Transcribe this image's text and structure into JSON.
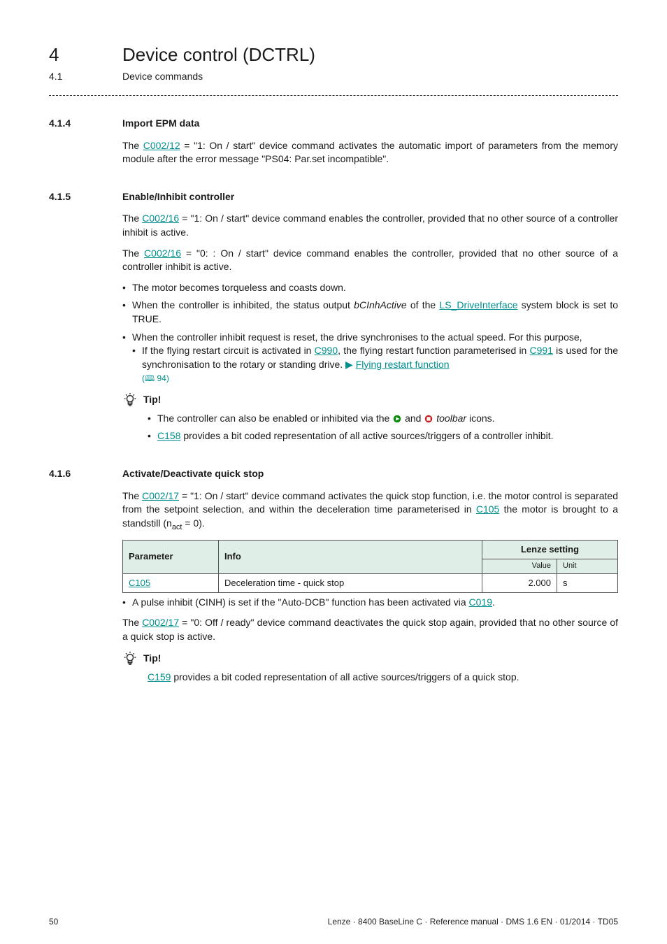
{
  "header": {
    "num": "4",
    "title": "Device control (DCTRL)"
  },
  "subheader": {
    "num": "4.1",
    "title": "Device commands"
  },
  "s414": {
    "num": "4.1.4",
    "title": "Import EPM data",
    "p1a": "The ",
    "p1link": "C002/12",
    "p1b": " = \"1: On / start\" device command activates the automatic import of parameters from the memory module after the error message \"PS04: Par.set incompatible\"."
  },
  "s415": {
    "num": "4.1.5",
    "title": "Enable/Inhibit controller",
    "p1a": "The ",
    "p1link": "C002/16",
    "p1b": " = \"1: On / start\" device command enables the controller, provided that no other source of a controller inhibit is active.",
    "p2a": "The ",
    "p2link": "C002/16",
    "p2b": " = \"0: : On / start\" device command enables the controller, provided that no other sour­ce of a controller inhibit is active.",
    "b1": "The motor becomes torqueless and coasts down.",
    "b2a": "When the controller is inhibited, the status output ",
    "b2italic": "bCInhActive",
    "b2b": " of the ",
    "b2link": "LS_DriveInterface",
    "b2c": " system block is set to TRUE.",
    "b3": "When the controller inhibit request is reset, the drive synchronises to the actual speed. For this purpose,",
    "b3sub_a": "If the flying restart circuit is activated in ",
    "b3sub_l1": "C990",
    "b3sub_b": ", the flying restart function parameterised in ",
    "b3sub_l2": "C991",
    "b3sub_c": " is used for the synchronisation to the rotary or standing drive.  ",
    "b3sub_arrow": "▶",
    "b3sub_l3": "Flying restart function",
    "b3sub_page": "(🕮 94)",
    "tip_label": "Tip!",
    "tip_b1a": "The controller can also be enabled or inhibited via the ",
    "tip_b1b": " and ",
    "tip_b1c": " ",
    "tip_b1italic": "toolbar",
    "tip_b1d": " icons.",
    "tip_b2link": "C158",
    "tip_b2": " provides a bit coded representation of all active sources/triggers of a controller in­hibit."
  },
  "s416": {
    "num": "4.1.6",
    "title": "Activate/Deactivate quick stop",
    "p1a": "The ",
    "p1link": "C002/17",
    "p1b": " = \"1: On / start\" device command activates the quick stop function, i.e. the motor con­trol is separated from the setpoint selection, and within the deceleration time parameterised in ",
    "p1link2": "C105",
    "p1c": " the motor is brought to a standstill (n",
    "p1sub": "act",
    "p1d": " = 0).",
    "table": {
      "h_param": "Parameter",
      "h_info": "Info",
      "h_setting": "Lenze setting",
      "sub_value": "Value",
      "sub_unit": "Unit",
      "r1_param": "C105",
      "r1_info": "Deceleration time - quick stop",
      "r1_value": "2.000",
      "r1_unit": "s"
    },
    "b1a": "A pulse inhibit (CINH) is set if the \"Auto-DCB\" function has been activated via ",
    "b1link": "C019",
    "b1b": ".",
    "p2a": "The ",
    "p2link": "C002/17",
    "p2b": " = \"0: Off / ready\" device command deactivates the quick stop again, provided that no other source of a quick stop is active.",
    "tip_label": "Tip!",
    "tip_link": "C159",
    "tip_text": " provides a bit coded representation of all active sources/triggers of a quick stop."
  },
  "footer": {
    "page": "50",
    "right": "Lenze · 8400 BaseLine C · Reference manual · DMS 1.6 EN · 01/2014 · TD05"
  },
  "chart_data": {
    "type": "table",
    "title": "Quick stop parameter",
    "columns": [
      "Parameter",
      "Info",
      "Value",
      "Unit"
    ],
    "rows": [
      [
        "C105",
        "Deceleration time - quick stop",
        2.0,
        "s"
      ]
    ]
  }
}
